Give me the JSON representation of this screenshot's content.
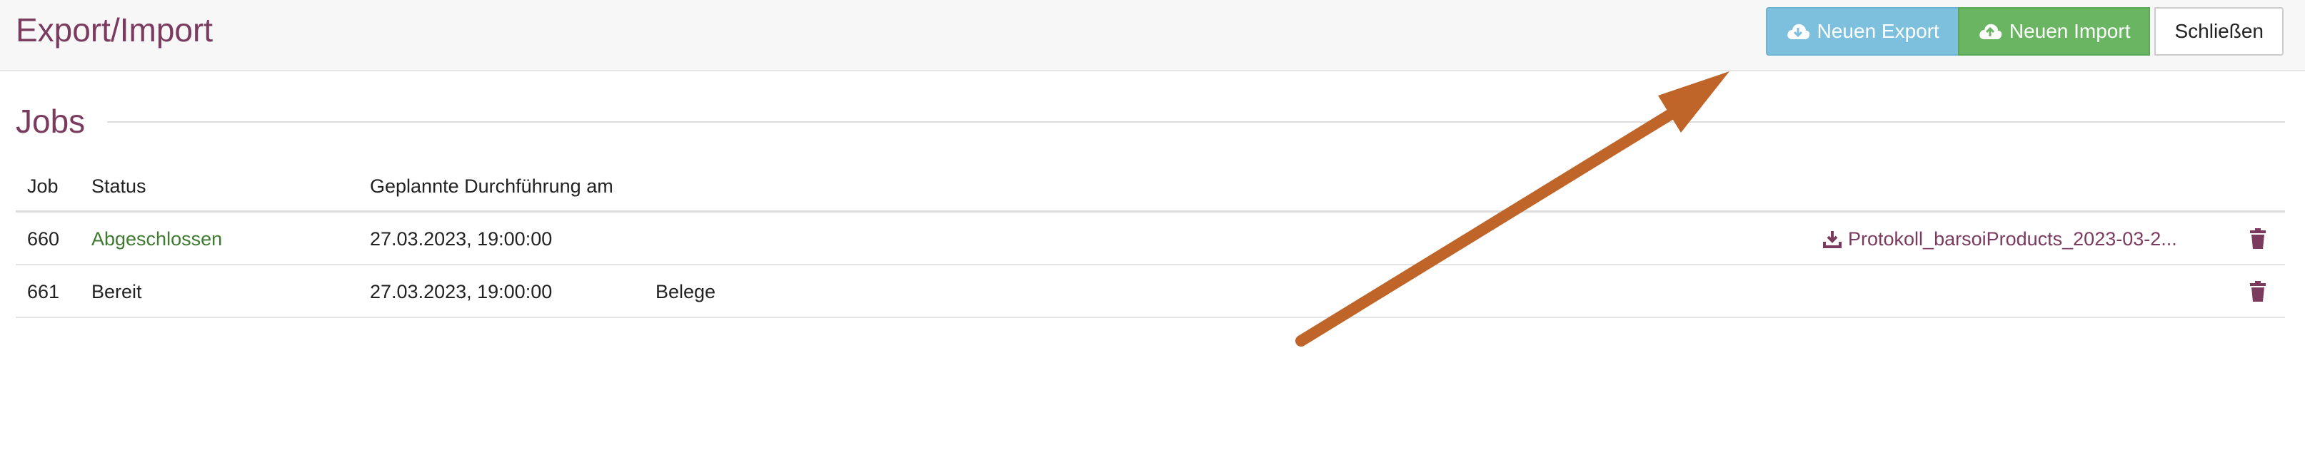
{
  "header": {
    "title": "Export/Import",
    "buttons": {
      "export_label": "Neuen Export",
      "import_label": "Neuen Import",
      "close_label": "Schließen"
    }
  },
  "section": {
    "title": "Jobs"
  },
  "table": {
    "columns": {
      "job": "Job",
      "status": "Status",
      "date": "Geplannte Durchführung am"
    },
    "rows": [
      {
        "job": "660",
        "status": "Abgeschlossen",
        "date": "27.03.2023, 19:00:00",
        "type": "",
        "file": "Protokoll_barsoiProducts_2023-03-2..."
      },
      {
        "job": "661",
        "status": "Bereit",
        "date": "27.03.2023, 19:00:00",
        "type": "Belege",
        "file": ""
      }
    ]
  },
  "colors": {
    "title": "#7b3b5f",
    "export_button": "#7cc0de",
    "import_button": "#6ab561",
    "status_done": "#3e7a2f",
    "annotation_arrow": "#c0652a"
  },
  "icons": {
    "export": "cloud-download-icon",
    "import": "cloud-upload-icon",
    "file": "download-icon",
    "delete": "trash-icon"
  }
}
